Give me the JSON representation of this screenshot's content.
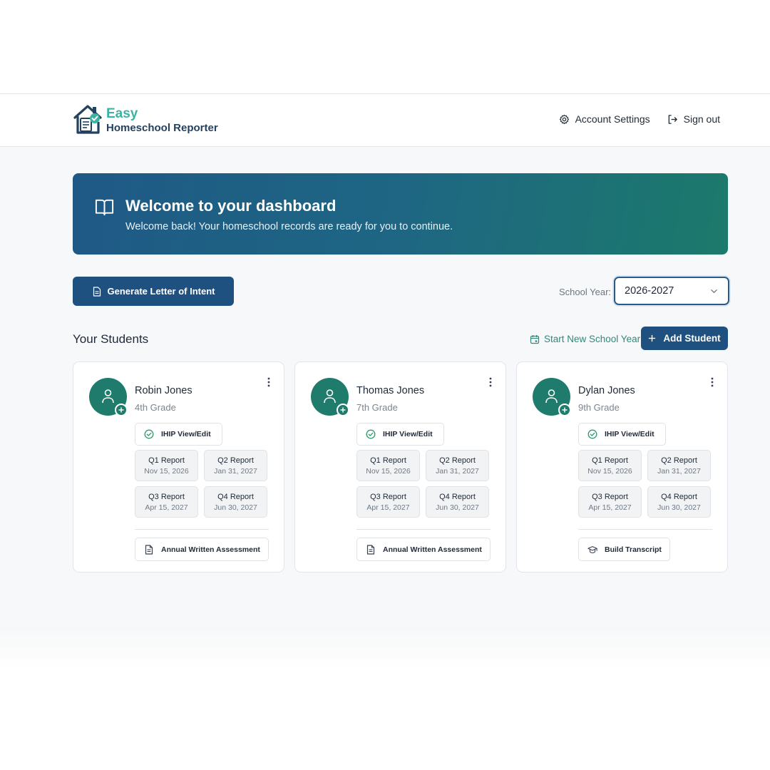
{
  "app": {
    "logo_line1": "Easy",
    "logo_line2": "Homeschool Reporter"
  },
  "header": {
    "account_settings": "Account Settings",
    "sign_out": "Sign out"
  },
  "banner": {
    "title": "Welcome to your dashboard",
    "subtitle": "Welcome back! Your homeschool records are ready for you to continue."
  },
  "toolbar": {
    "letter_of_intent": "Generate Letter of Intent",
    "school_year_label": "School Year:",
    "school_year_value": "2026-2027"
  },
  "students_section": {
    "title": "Your Students",
    "start_new_year": "Start New School Year",
    "add_student": "Add Student"
  },
  "students": [
    {
      "name": "Robin Jones",
      "grade": "4th Grade",
      "ihip": "IHIP View/Edit",
      "reports": [
        {
          "title": "Q1 Report",
          "date": "Nov 15, 2026"
        },
        {
          "title": "Q2 Report",
          "date": "Jan 31, 2027"
        },
        {
          "title": "Q3 Report",
          "date": "Apr 15, 2027"
        },
        {
          "title": "Q4 Report",
          "date": "Jun 30, 2027"
        }
      ],
      "bottom_action": "Annual Written Assessment",
      "bottom_icon": "document-icon"
    },
    {
      "name": "Thomas Jones",
      "grade": "7th Grade",
      "ihip": "IHIP View/Edit",
      "reports": [
        {
          "title": "Q1 Report",
          "date": "Nov 15, 2026"
        },
        {
          "title": "Q2 Report",
          "date": "Jan 31, 2027"
        },
        {
          "title": "Q3 Report",
          "date": "Apr 15, 2027"
        },
        {
          "title": "Q4 Report",
          "date": "Jun 30, 2027"
        }
      ],
      "bottom_action": "Annual Written Assessment",
      "bottom_icon": "document-icon"
    },
    {
      "name": "Dylan Jones",
      "grade": "9th Grade",
      "ihip": "IHIP View/Edit",
      "reports": [
        {
          "title": "Q1 Report",
          "date": "Nov 15, 2026"
        },
        {
          "title": "Q2 Report",
          "date": "Jan 31, 2027"
        },
        {
          "title": "Q3 Report",
          "date": "Apr 15, 2027"
        },
        {
          "title": "Q4 Report",
          "date": "Jun 30, 2027"
        }
      ],
      "bottom_action": "Build Transcript",
      "bottom_icon": "graduation-cap-icon"
    }
  ],
  "colors": {
    "primary": "#1f5180",
    "accent_teal": "#1f7c6d",
    "logo_teal": "#3bb3a3"
  }
}
